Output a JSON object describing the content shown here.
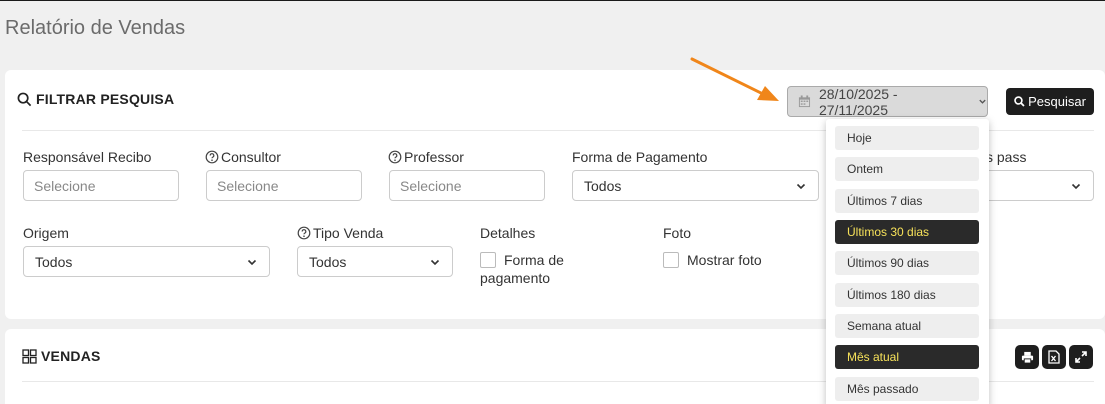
{
  "page": {
    "title": "Relatório de Vendas"
  },
  "filter": {
    "title": "FILTRAR PESQUISA",
    "date_range": "28/10/2025 - 27/11/2025",
    "search_label": "Pesquisar",
    "responsavel": {
      "label": "Responsável Recibo",
      "placeholder": "Selecione"
    },
    "consultor": {
      "label": "Consultor",
      "placeholder": "Selecione"
    },
    "professor": {
      "label": "Professor",
      "placeholder": "Selecione"
    },
    "forma_pagamento": {
      "label": "Forma de Pagamento",
      "value": "Todos"
    },
    "hidden_partial_label": "s pass",
    "origem": {
      "label": "Origem",
      "value": "Todos"
    },
    "tipo_venda": {
      "label": "Tipo Venda",
      "value": "Todos"
    },
    "detalhes": {
      "label": "Detalhes",
      "option_line1": "Forma de",
      "option_line2": "pagamento"
    },
    "foto": {
      "label": "Foto",
      "option": "Mostrar foto"
    }
  },
  "date_presets": [
    {
      "label": "Hoje",
      "active": false
    },
    {
      "label": "Ontem",
      "active": false
    },
    {
      "label": "Últimos 7 dias",
      "active": false
    },
    {
      "label": "Últimos 30 dias",
      "active": true
    },
    {
      "label": "Últimos 90 dias",
      "active": false
    },
    {
      "label": "Últimos 180 dias",
      "active": false
    },
    {
      "label": "Semana atual",
      "active": false
    },
    {
      "label": "Mês atual",
      "active": true
    },
    {
      "label": "Mês passado",
      "active": false
    }
  ],
  "vendas": {
    "title": "VENDAS"
  },
  "colors": {
    "arrow": "#f0861a",
    "active_text": "#f7e25a",
    "dark_button": "#1e1e1e"
  },
  "icons": [
    "search-icon",
    "calendar-icon",
    "chevron-down-icon",
    "help-circle-icon",
    "grid-icon",
    "print-icon",
    "excel-icon",
    "expand-icon",
    "arrow-annotation"
  ]
}
